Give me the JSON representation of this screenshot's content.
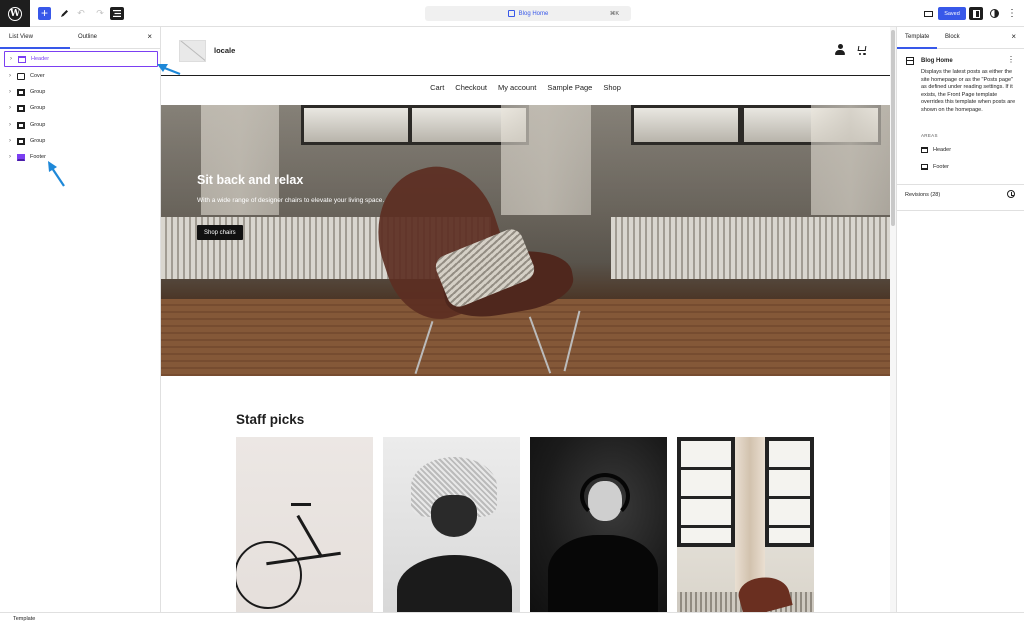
{
  "toolbar": {
    "add_icon": "plus-icon",
    "document_title": "Blog Home",
    "shortcut": "⌘K",
    "saved_label": "Saved",
    "colors": {
      "accent": "#3858e9",
      "selection": "#7b3ff2",
      "dark": "#1e1e1e"
    }
  },
  "left_panel": {
    "tabs": [
      "List View",
      "Outline"
    ],
    "items": [
      {
        "label": "Header",
        "icon": "header-template-part-icon",
        "selected": true
      },
      {
        "label": "Cover",
        "icon": "cover-block-icon"
      },
      {
        "label": "Group",
        "icon": "group-block-icon"
      },
      {
        "label": "Group",
        "icon": "group-block-icon"
      },
      {
        "label": "Group",
        "icon": "group-block-icon"
      },
      {
        "label": "Group",
        "icon": "group-block-icon"
      },
      {
        "label": "Footer",
        "icon": "footer-template-part-icon"
      }
    ]
  },
  "site": {
    "title": "locale",
    "nav": [
      "Cart",
      "Checkout",
      "My account",
      "Sample Page",
      "Shop"
    ],
    "hero": {
      "title": "Sit back and relax",
      "text": "With a wide range of designer chairs to elevate your living space.",
      "button": "Shop chairs"
    },
    "staff_picks_title": "Staff picks"
  },
  "right_panel": {
    "tabs": [
      "Template",
      "Block"
    ],
    "template_name": "Blog Home",
    "description": "Displays the latest posts as either the site homepage or as the \"Posts page\" as defined under reading settings. If it exists, the Front Page template overrides this template when posts are shown on the homepage.",
    "areas_label": "AREAS",
    "areas": [
      "Header",
      "Footer"
    ],
    "revisions": "Revisions (28)"
  },
  "status_bar": {
    "breadcrumb": "Template"
  }
}
